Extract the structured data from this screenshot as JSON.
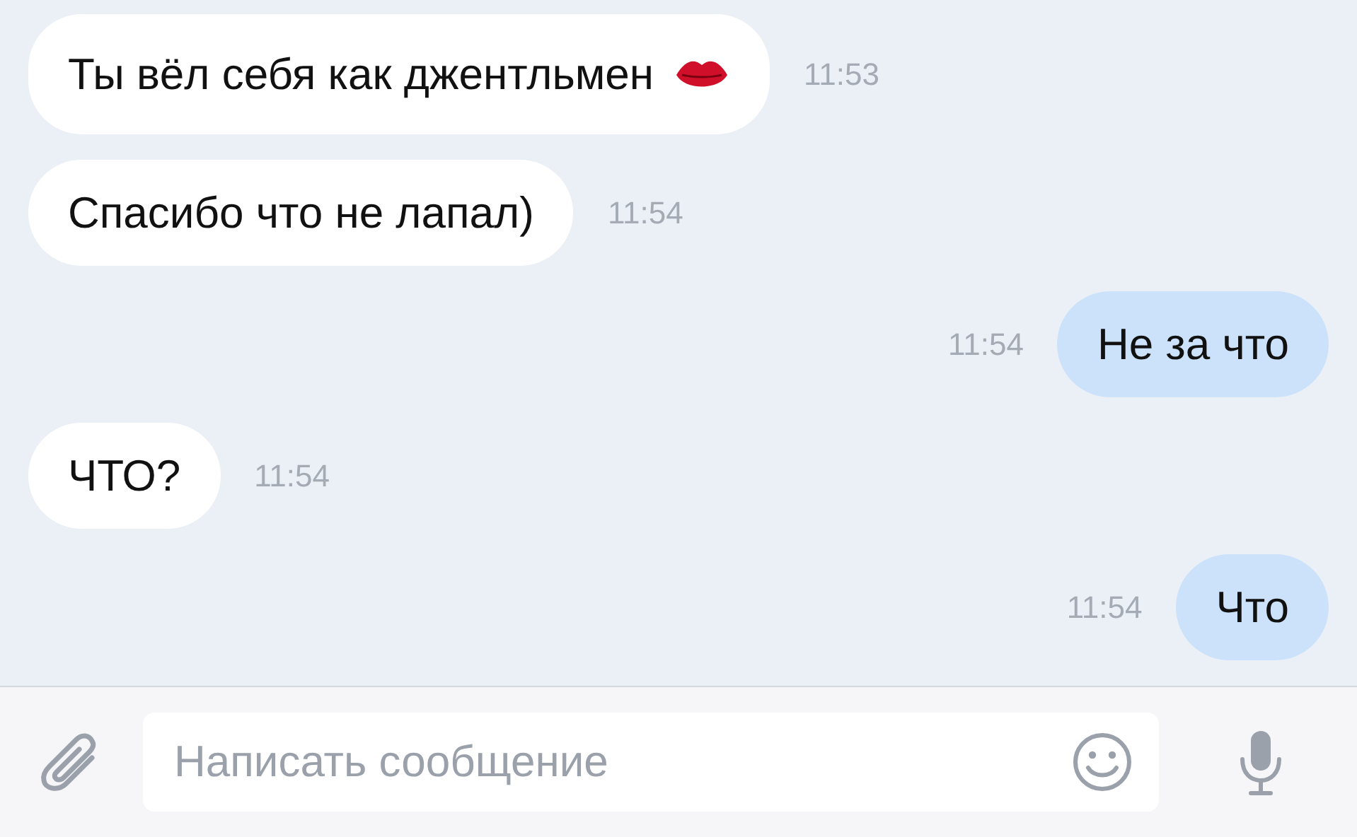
{
  "messages": [
    {
      "kind": "incoming",
      "text": "Ты вёл себя как джентльмен",
      "sticker": {
        "kind": "lips"
      },
      "time": "11:53"
    },
    {
      "kind": "incoming",
      "text": "Спасибо что не лапал)",
      "time": "11:54"
    },
    {
      "kind": "outgoing",
      "text": "Не за что",
      "time": "11:54"
    },
    {
      "kind": "incoming",
      "text": "ЧТО?",
      "time": "11:54"
    },
    {
      "kind": "outgoing",
      "text": "Что",
      "time": "11:54"
    }
  ],
  "composer": {
    "placeholder": "Написать сообщение"
  }
}
